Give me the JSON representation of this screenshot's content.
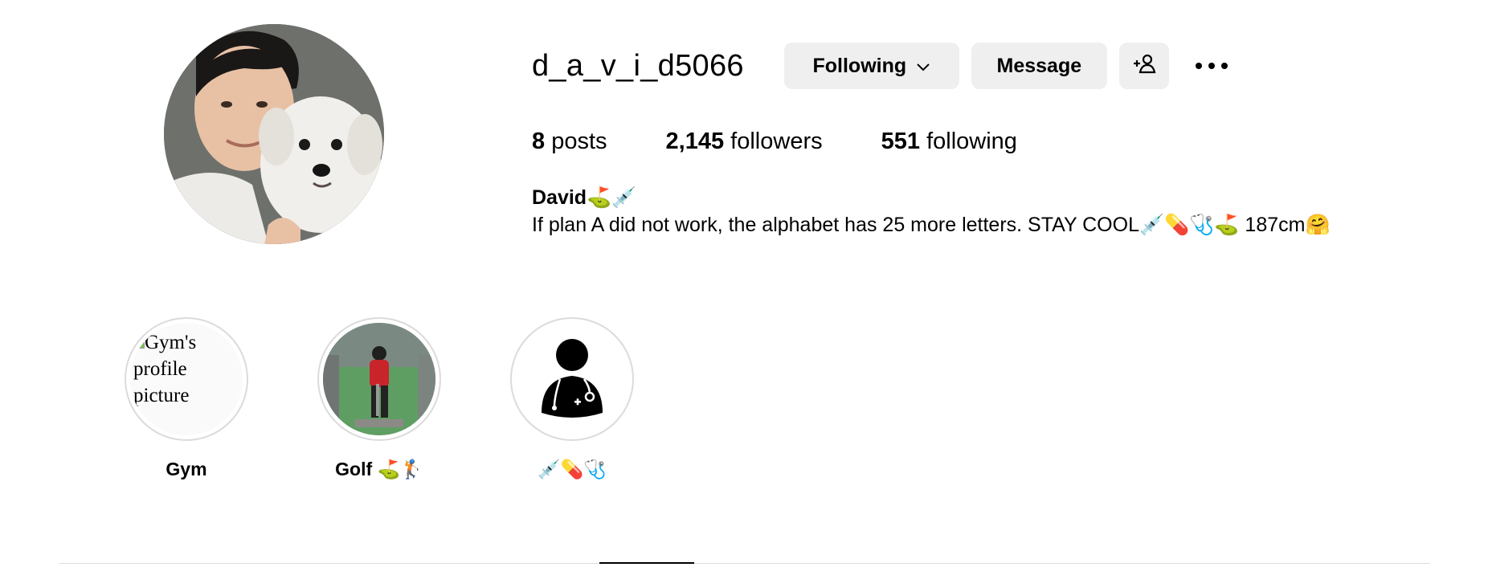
{
  "profile": {
    "username": "d_a_v_i_d5066",
    "buttons": {
      "following_label": "Following",
      "message_label": "Message"
    },
    "stats": {
      "posts_count": "8",
      "posts_label": "posts",
      "followers_count": "2,145",
      "followers_label": "followers",
      "following_count": "551",
      "following_label": "following"
    },
    "bio": {
      "name": "David⛳💉",
      "text": "If plan A did not work, the alphabet has 25 more letters. STAY COOL💉💊🩺⛳ 187cm🤗"
    },
    "avatar_icon": "profile-photo"
  },
  "highlights": [
    {
      "label": "Gym",
      "alt_text": "Gym's profile picture"
    },
    {
      "label": "Golf ⛳🏌️"
    },
    {
      "label": "💉💊🩺"
    }
  ],
  "colors": {
    "button_bg": "#efefef",
    "border": "#dbdbdb",
    "text": "#000000"
  }
}
